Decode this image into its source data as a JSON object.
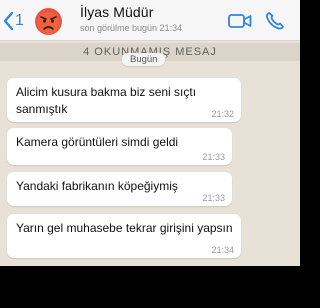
{
  "header": {
    "back_count": "1",
    "contact_name": "İlyas Müdür",
    "last_seen": "son görülme bugün 21:34"
  },
  "unread_banner": "4 OKUNMAMIŞ MESAJ",
  "date_label": "Bugün",
  "messages": [
    {
      "text": "Alicim kusura bakma biz seni sıçtı sanmıştık",
      "time": "21:32"
    },
    {
      "text": "Kamera görüntüleri simdi geldi",
      "time": "21:33"
    },
    {
      "text": "Yandaki fabrikanın köpeğiymiş",
      "time": "21:33"
    },
    {
      "text": "Yarın gel muhasebe tekrar girişini yapsın",
      "time": "21:34"
    }
  ],
  "icons": {
    "back": "chevron-left-icon",
    "avatar": "angry-face-emoji",
    "video": "video-camera-icon",
    "phone": "phone-icon"
  },
  "colors": {
    "accent": "#2e86de",
    "chat_background": "#e8e1d8",
    "bubble": "#ffffff",
    "header": "#f6f6f6"
  }
}
